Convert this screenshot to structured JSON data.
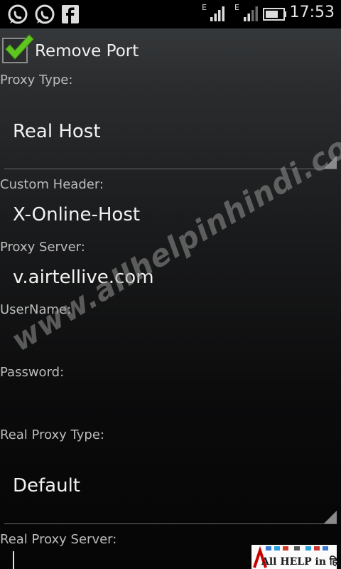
{
  "status_bar": {
    "time": "17:53",
    "network_type_1": "E",
    "network_type_2": "E",
    "icons": [
      "whatsapp-icon",
      "whatsapp-icon",
      "facebook-icon",
      "signal-icon",
      "signal-icon",
      "battery-icon"
    ]
  },
  "form": {
    "remove_port": {
      "label": "Remove Port",
      "checked": true
    },
    "proxy_type": {
      "label": "Proxy Type:",
      "value": "Real Host"
    },
    "custom_header": {
      "label": "Custom Header:",
      "value": "X-Online-Host"
    },
    "proxy_server": {
      "label": "Proxy Server:",
      "value": "v.airtellive.com"
    },
    "username": {
      "label": "UserName:",
      "value": ""
    },
    "password": {
      "label": "Password:",
      "value": ""
    },
    "real_proxy_type": {
      "label": "Real Proxy Type:",
      "value": "Default"
    },
    "real_proxy_server": {
      "label": "Real Proxy Server:",
      "value": ""
    }
  },
  "overlay": {
    "watermark": "www.allhelpinhindi.com",
    "logo_text": "All HELP in हिन्दी"
  },
  "colors": {
    "check_green": "#5fc520",
    "text_primary": "#f2f2f2",
    "text_label": "#bcbcbc"
  }
}
